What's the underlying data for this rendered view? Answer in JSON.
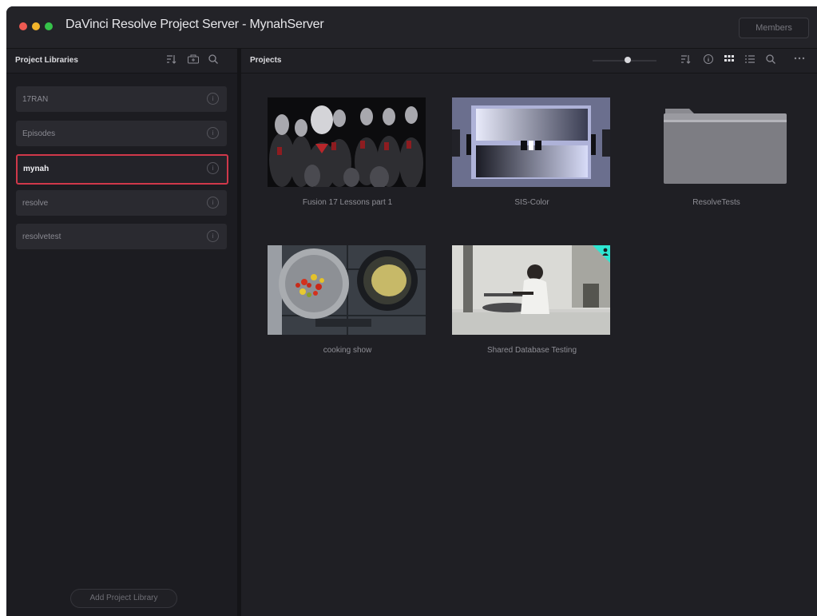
{
  "window": {
    "title": "DaVinci Resolve Project Server - MynahServer",
    "members_label": "Members"
  },
  "sidebar": {
    "header": "Project Libraries",
    "items": [
      {
        "label": "17RAN",
        "selected": false
      },
      {
        "label": "Episodes",
        "selected": false
      },
      {
        "label": "mynah",
        "selected": true
      },
      {
        "label": "resolve",
        "selected": false
      },
      {
        "label": "resolvetest",
        "selected": false
      }
    ],
    "add_button_label": "Add Project Library",
    "icons": [
      "sort-icon",
      "add-library-icon",
      "search-icon"
    ]
  },
  "projects": {
    "header": "Projects",
    "toolbar_icons": [
      "zoom-slider",
      "sort-icon",
      "info-icon",
      "grid-view-icon",
      "list-view-icon",
      "search-icon",
      "more-icon"
    ],
    "zoom_level": 0.55,
    "items": [
      {
        "label": "Fusion 17 Lessons part 1",
        "kind": "project",
        "thumb": "armored-crowd"
      },
      {
        "label": "SIS-Color",
        "kind": "project",
        "thumb": "color-chart"
      },
      {
        "label": "ResolveTests",
        "kind": "folder",
        "thumb": "folder"
      },
      {
        "label": "cooking show",
        "kind": "project",
        "thumb": "cooking-pans"
      },
      {
        "label": "Shared Database Testing",
        "kind": "project",
        "thumb": "person-at-table",
        "shared": true
      }
    ]
  },
  "colors": {
    "accent_selected": "#d0384a",
    "shared_badge": "#2ee6d2"
  }
}
